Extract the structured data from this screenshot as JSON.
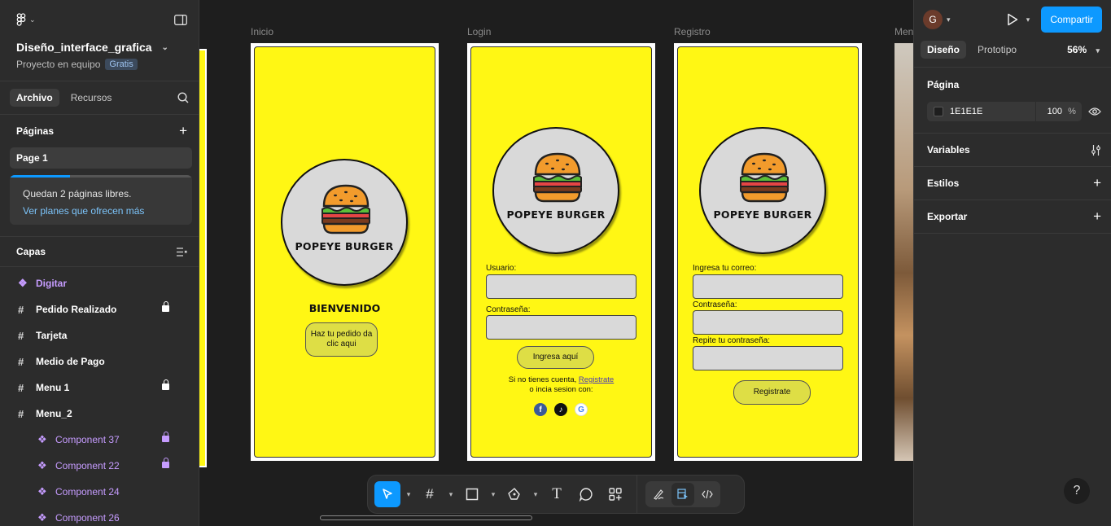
{
  "file": {
    "name": "Diseño_interface_grafica",
    "team": "Proyecto en equipo",
    "plan_badge": "Gratis"
  },
  "left_tabs": [
    "Archivo",
    "Recursos"
  ],
  "pages": {
    "title": "Páginas",
    "items": [
      "Page 1"
    ],
    "upgrade_text": "Quedan 2 páginas libres.",
    "upgrade_link": "Ver planes que ofrecen más",
    "pages_used_fraction": 0.33
  },
  "layers": {
    "title": "Capas",
    "items": [
      {
        "label": "Digitar",
        "type": "component",
        "locked": false
      },
      {
        "label": "Pedido Realizado",
        "type": "frame",
        "locked": true
      },
      {
        "label": "Tarjeta",
        "type": "frame",
        "locked": false
      },
      {
        "label": "Medio de Pago",
        "type": "frame",
        "locked": false
      },
      {
        "label": "Menu 1",
        "type": "frame",
        "locked": true
      },
      {
        "label": "Menu_2",
        "type": "frame",
        "locked": false
      },
      {
        "label": "Component 37",
        "type": "component-child",
        "locked": true
      },
      {
        "label": "Component 22",
        "type": "component-child",
        "locked": true
      },
      {
        "label": "Component 24",
        "type": "component-child",
        "locked": false
      },
      {
        "label": "Component 26",
        "type": "component-child",
        "locked": false
      }
    ]
  },
  "canvas": {
    "frames": {
      "inicio": {
        "label": "Inicio",
        "brand": "POPEYE BURGER",
        "welcome": "BIENVENIDO",
        "cta": "Haz tu pedido da clic aqui"
      },
      "login": {
        "label": "Login",
        "brand": "POPEYE BURGER",
        "user_label": "Usuario:",
        "pass_label": "Contraseña:",
        "submit": "Ingresa aquí",
        "signup_text": "Si no tienes cuenta,",
        "signup_link": "Registrate",
        "social_text": "o incia sesion con:"
      },
      "registro": {
        "label": "Registro",
        "brand": "POPEYE BURGER",
        "email_label": "Ingresa tu correo:",
        "pass_label": "Contraseña:",
        "repeat_label": "Repite tu contraseña:",
        "submit": "Registrate"
      },
      "menu": {
        "label": "Men"
      }
    },
    "brand_colors": {
      "screen_bg": "#fff714",
      "button": "#dede45",
      "circle": "#d9d9d9"
    }
  },
  "toolbar": {
    "tools": [
      "move-tool",
      "frame-tool",
      "rectangle-tool",
      "pen-tool",
      "text-tool",
      "comment-tool",
      "actions-tool"
    ],
    "modes": [
      "draw-mode",
      "design-mode",
      "dev-mode"
    ]
  },
  "right": {
    "avatar_initial": "G",
    "share_label": "Compartir",
    "tabs": [
      "Diseño",
      "Prototipo"
    ],
    "zoom": "56%",
    "page_section": "Página",
    "bg_color": "1E1E1E",
    "bg_opacity": "100",
    "percent_sign": "%",
    "variables": "Variables",
    "styles": "Estilos",
    "export": "Exportar",
    "help": "?"
  },
  "accent": "#0d99ff"
}
